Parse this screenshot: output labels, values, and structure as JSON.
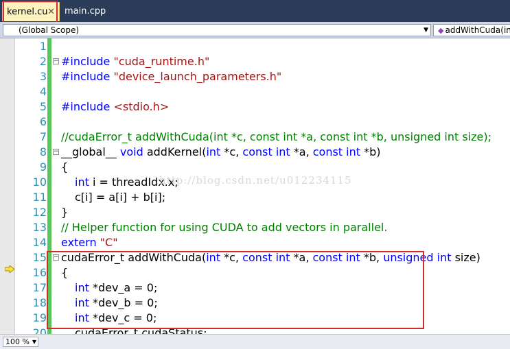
{
  "tabs": [
    {
      "label": "kernel.cu",
      "close": "✕"
    },
    {
      "label": "main.cpp"
    }
  ],
  "navbar": {
    "scope": "(Global Scope)",
    "member": "addWithCuda(in"
  },
  "line_numbers": [
    "1",
    "2",
    "3",
    "4",
    "5",
    "6",
    "7",
    "8",
    "9",
    "10",
    "11",
    "12",
    "13",
    "14",
    "15",
    "16",
    "17",
    "18",
    "19",
    "20"
  ],
  "code": {
    "l2_directive": "#include ",
    "l2_file": "\"cuda_runtime.h\"",
    "l3_directive": "#include ",
    "l3_file": "\"device_launch_parameters.h\"",
    "l5_directive": "#include ",
    "l5_file": "<stdio.h>",
    "l7_comment": "//cudaError_t addWithCuda(int *c, const int *a, const int *b, unsigned int size);",
    "l8_a": "__global__ ",
    "l8_b": "void",
    "l8_c": " addKernel(",
    "l8_d": "int",
    "l8_e": " *c, ",
    "l8_f": "const int",
    "l8_g": " *a, ",
    "l8_h": "const int",
    "l8_i": " *b)",
    "l9": "{",
    "l10_kw": "int",
    "l10_rest": " i = threadIdx.x;",
    "l11": "c[i] = a[i] + b[i];",
    "l12": "}",
    "l13_comment": "// Helper function for using CUDA to add vectors in parallel.",
    "l14_kw": "extern ",
    "l14_str": "\"C\"",
    "l15_a": "cudaError_t addWithCuda(",
    "l15_b": "int",
    "l15_c": " *c, ",
    "l15_d": "const int",
    "l15_e": " *a, ",
    "l15_f": "const int",
    "l15_g": " *b, ",
    "l15_h": "unsigned int",
    "l15_i": " size)",
    "l16": "{",
    "l17_kw": "int",
    "l17_rest": " *dev_a = 0;",
    "l18_kw": "int",
    "l18_rest": " *dev_b = 0;",
    "l19_kw": "int",
    "l19_rest": " *dev_c = 0;",
    "l20": "cudaError_t cudaStatus;"
  },
  "watermark": "http://blog.csdn.net/u012234115",
  "status": {
    "zoom": "100 %"
  },
  "colors": {
    "tab_strip": "#2b3c59",
    "active_tab": "#fdf4bf",
    "keyword": "#0000ff",
    "string": "#a31515",
    "comment": "#008000",
    "line_number": "#2b91af",
    "change_bar": "#58c75a",
    "highlight_box": "#d12b2b"
  }
}
